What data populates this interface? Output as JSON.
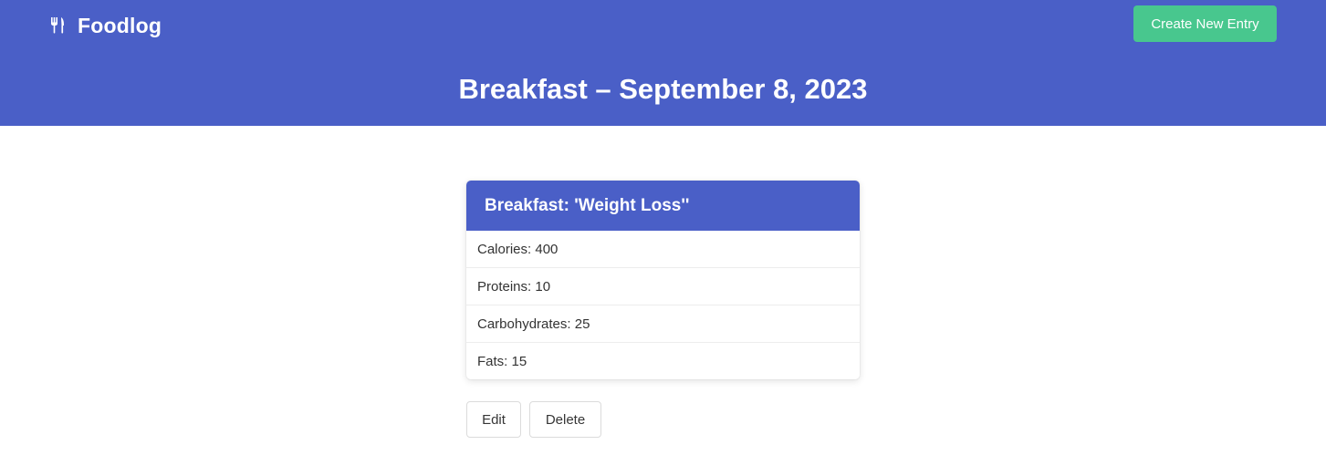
{
  "header": {
    "brand_name": "Foodlog",
    "brand_icon": "utensils-icon",
    "create_button_label": "Create New Entry",
    "page_title": "Breakfast – September 8, 2023"
  },
  "entry": {
    "title": "Breakfast: 'Weight Loss''",
    "rows": [
      {
        "label": "Calories: 400"
      },
      {
        "label": "Proteins: 10"
      },
      {
        "label": "Carbohydrates: 25"
      },
      {
        "label": "Fats: 15"
      }
    ]
  },
  "actions": {
    "edit_label": "Edit",
    "delete_label": "Delete"
  },
  "colors": {
    "primary": "#4a5fc7",
    "success": "#48c78e",
    "text": "#333333"
  }
}
